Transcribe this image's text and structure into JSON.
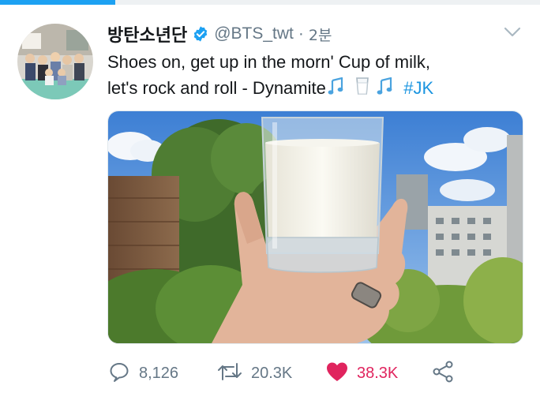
{
  "tweet": {
    "display_name": "방탄소년단",
    "handle": "@BTS_twt",
    "separator": "·",
    "time": "2분",
    "text_line1": "Shoes on, get up in the morn' Cup of milk,",
    "text_line2_plain": "let's rock and roll - Dynamite",
    "hashtag": "#JK",
    "emojis": [
      "music-notes-icon",
      "milk-glass-icon",
      "music-notes-icon"
    ]
  },
  "stats": {
    "replies": "8,126",
    "retweets": "20.3K",
    "likes": "38.3K"
  },
  "colors": {
    "accent": "#1da1f2",
    "hashtag": "#1b95e0",
    "like": "#e0245e",
    "muted": "#657786"
  }
}
